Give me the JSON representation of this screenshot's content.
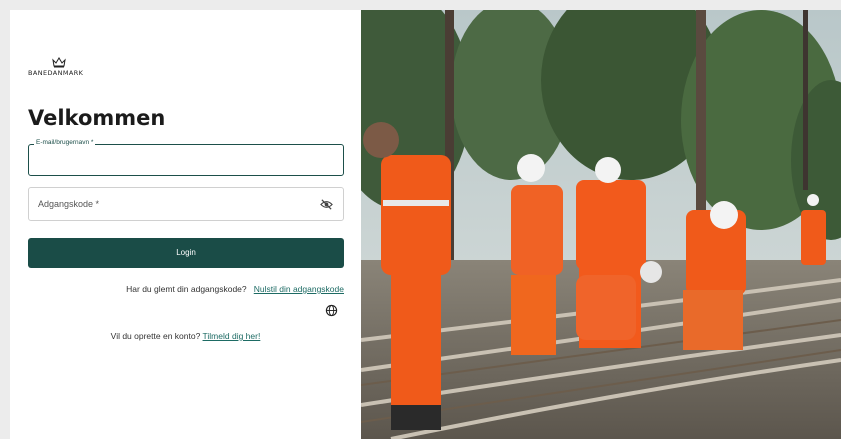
{
  "brand": {
    "name": "BANEDANMARK"
  },
  "login": {
    "title": "Velkommen",
    "email_label": "E-mail/brugernavn *",
    "email_value": "",
    "password_label": "Adgangskode *",
    "login_button": "Login",
    "forgot_text": "Har du glemt din adgangskode?",
    "forgot_link": "Nulstil din adgangskode",
    "signup_text": "Vil du oprette en konto?",
    "signup_link": "Tilmeld dig her!"
  },
  "icons": {
    "eye": "eye-off-icon",
    "language": "globe-icon",
    "logo": "crown-icon"
  },
  "colors": {
    "primary": "#1a4c47",
    "link": "#1d6b64",
    "vest": "#f05a1a"
  }
}
